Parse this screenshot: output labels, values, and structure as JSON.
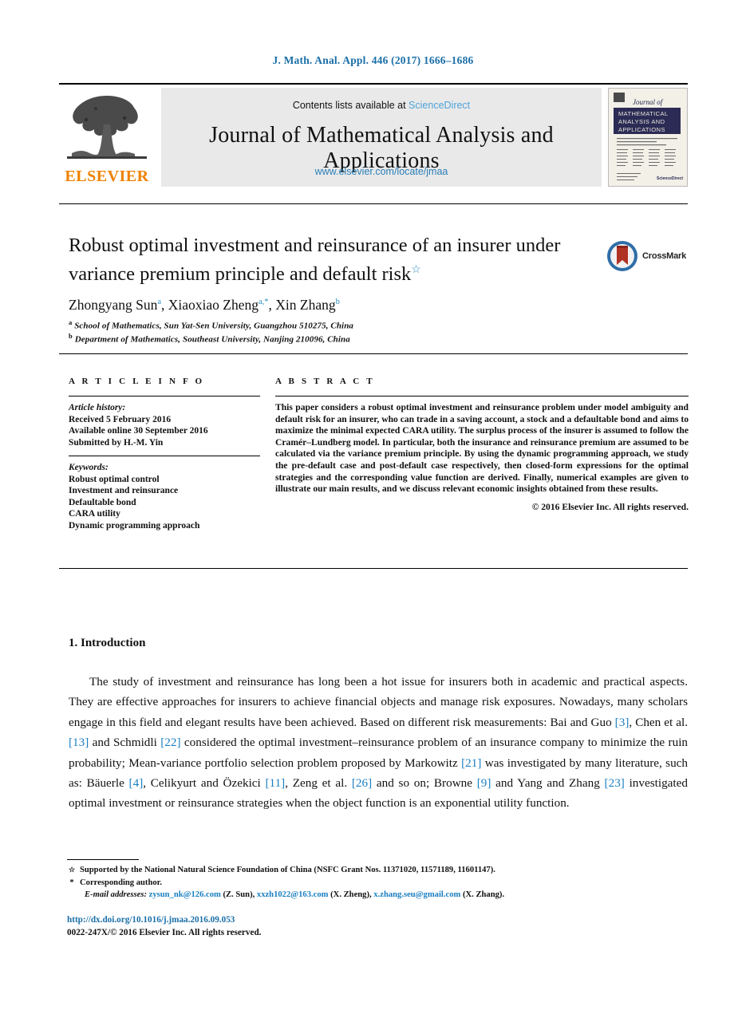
{
  "running_head": "J. Math. Anal. Appl. 446 (2017) 1666–1686",
  "masthead": {
    "publisher_name": "ELSEVIER",
    "contents_prefix": "Contents lists available at ",
    "contents_link": "ScienceDirect",
    "journal_title": "Journal of Mathematical Analysis and Applications",
    "journal_url": "www.elsevier.com/locate/jmaa",
    "cover": {
      "journal_of": "Journal of",
      "line1": "MATHEMATICAL",
      "line2": "ANALYSIS AND",
      "line3": "APPLICATIONS",
      "publisher": "ScienceDirect"
    }
  },
  "article": {
    "title_line1": "Robust optimal investment and reinsurance of an insurer under",
    "title_line2": "variance premium principle and default risk",
    "title_footnote_mark": "☆",
    "crossmark_label": "CrossMark",
    "authors_html": "Zhongyang Sun, Xiaoxiao Zheng, Xin Zhang",
    "authors": [
      {
        "name": "Zhongyang Sun",
        "marks": "a"
      },
      {
        "name": "Xiaoxiao Zheng",
        "marks": "a,*"
      },
      {
        "name": "Xin Zhang",
        "marks": "b"
      }
    ],
    "affiliations": [
      {
        "mark": "a",
        "text": "School of Mathematics, Sun Yat-Sen University, Guangzhou 510275, China"
      },
      {
        "mark": "b",
        "text": "Department of Mathematics, Southeast University, Nanjing 210096, China"
      }
    ]
  },
  "article_info": {
    "heading": "A R T I C L E   I N F O",
    "history_label": "Article history:",
    "history": [
      "Received 5 February 2016",
      "Available online 30 September 2016",
      "Submitted by H.-M. Yin"
    ],
    "keywords_label": "Keywords:",
    "keywords": [
      "Robust optimal control",
      "Investment and reinsurance",
      "Defaultable bond",
      "CARA utility",
      "Dynamic programming approach"
    ]
  },
  "abstract": {
    "heading": "A B S T R A C T",
    "text": "This paper considers a robust optimal investment and reinsurance problem under model ambiguity and default risk for an insurer, who can trade in a saving account, a stock and a defaultable bond and aims to maximize the minimal expected CARA utility. The surplus process of the insurer is assumed to follow the Cramér–Lundberg model. In particular, both the insurance and reinsurance premium are assumed to be calculated via the variance premium principle. By using the dynamic programming approach, we study the pre-default case and post-default case respectively, then closed-form expressions for the optimal strategies and the corresponding value function are derived. Finally, numerical examples are given to illustrate our main results, and we discuss relevant economic insights obtained from these results.",
    "copyright": "© 2016 Elsevier Inc. All rights reserved."
  },
  "introduction": {
    "heading": "1. Introduction",
    "paragraph_parts": [
      {
        "t": "The study of investment and reinsurance has long been a hot issue for insurers both in academic and practical aspects. They are effective approaches for insurers to achieve financial objects and manage risk exposures. Nowadays, many scholars engage in this field and elegant results have been achieved. Based on different risk measurements: Bai and Guo "
      },
      {
        "r": "[3]"
      },
      {
        "t": ", Chen et al. "
      },
      {
        "r": "[13]"
      },
      {
        "t": " and Schmidli "
      },
      {
        "r": "[22]"
      },
      {
        "t": " considered the optimal investment–reinsurance problem of an insurance company to minimize the ruin probability; Mean-variance portfolio selection problem proposed by Markowitz "
      },
      {
        "r": "[21]"
      },
      {
        "t": " was investigated by many literature, such as: Bäuerle "
      },
      {
        "r": "[4]"
      },
      {
        "t": ", Celikyurt and Özekici "
      },
      {
        "r": "[11]"
      },
      {
        "t": ", Zeng et al. "
      },
      {
        "r": "[26]"
      },
      {
        "t": " and so on; Browne "
      },
      {
        "r": "[9]"
      },
      {
        "t": " and Yang and Zhang "
      },
      {
        "r": "[23]"
      },
      {
        "t": " investigated optimal investment or reinsurance strategies when the object function is an exponential utility function."
      }
    ]
  },
  "footnotes": {
    "funding_mark": "☆",
    "funding": "Supported by the National Natural Science Foundation of China (NSFC Grant Nos. 11371020, 11571189, 11601147).",
    "corresponding_mark": "*",
    "corresponding": "Corresponding author.",
    "email_label": "E-mail addresses:",
    "emails": [
      {
        "address": "zysun_nk@126.com",
        "owner": "(Z. Sun)"
      },
      {
        "address": "xxzh1022@163.com",
        "owner": "(X. Zheng)"
      },
      {
        "address": "x.zhang.seu@gmail.com",
        "owner": "(X. Zhang)"
      }
    ]
  },
  "doi": {
    "link": "http://dx.doi.org/10.1016/j.jmaa.2016.09.053",
    "issn": "0022-247X/© 2016 Elsevier Inc. All rights reserved."
  },
  "colors": {
    "link_blue": "#1a7fc1",
    "header_blue": "#1a6fa8",
    "sciencedirect_blue": "#4da3d8",
    "elsevier_orange": "#ef8200",
    "cover_navy": "#2b2b55",
    "crossmark_blue": "#2f6ea8",
    "crossmark_red": "#b03224"
  }
}
